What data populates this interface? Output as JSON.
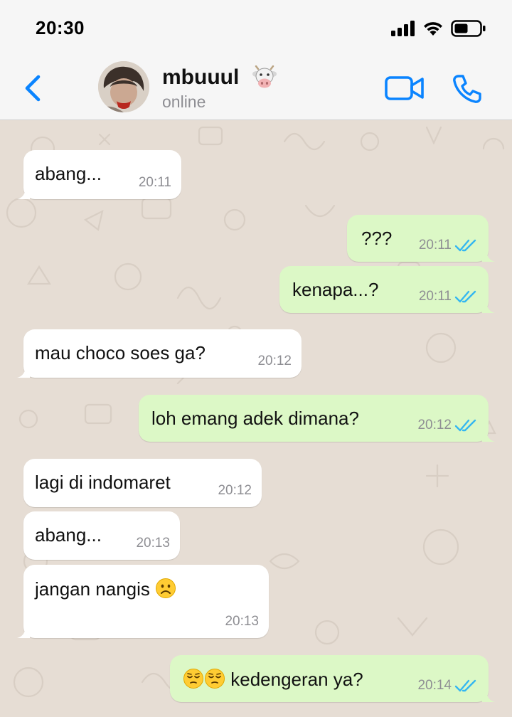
{
  "status_bar": {
    "time": "20:30"
  },
  "header": {
    "contact_name": "mbuuul",
    "contact_status": "online"
  },
  "messages": [
    {
      "direction": "incoming",
      "text": "abang...",
      "time": "20:11"
    },
    {
      "direction": "outgoing",
      "text": "???",
      "time": "20:11",
      "read": true
    },
    {
      "direction": "outgoing",
      "text": "kenapa...?",
      "time": "20:11",
      "read": true
    },
    {
      "direction": "incoming",
      "text": "mau choco soes ga?",
      "time": "20:12"
    },
    {
      "direction": "outgoing",
      "text": "loh emang adek dimana?",
      "time": "20:12",
      "read": true
    },
    {
      "direction": "incoming",
      "text": "lagi di indomaret",
      "time": "20:12"
    },
    {
      "direction": "incoming",
      "text": "abang...",
      "time": "20:13"
    },
    {
      "direction": "incoming",
      "text": "jangan nangis",
      "time": "20:13",
      "emoji_after": "frowning-face"
    },
    {
      "direction": "outgoing",
      "text": "kedengeran ya?",
      "time": "20:14",
      "read": true,
      "emoji_before": [
        "pensive-face",
        "pensive-face"
      ]
    }
  ],
  "colors": {
    "accent": "#0a84ff",
    "incoming_bubble": "#ffffff",
    "outgoing_bubble": "#dcf8c6",
    "read_ticks": "#34b7f1",
    "wallpaper": "#e6ddd4"
  },
  "icons": [
    "signal-icon",
    "wifi-icon",
    "battery-icon",
    "back-chevron-icon",
    "video-call-icon",
    "phone-icon",
    "cow-face-emoji",
    "read-receipt-icon",
    "frowning-face-emoji",
    "pensive-face-emoji"
  ]
}
